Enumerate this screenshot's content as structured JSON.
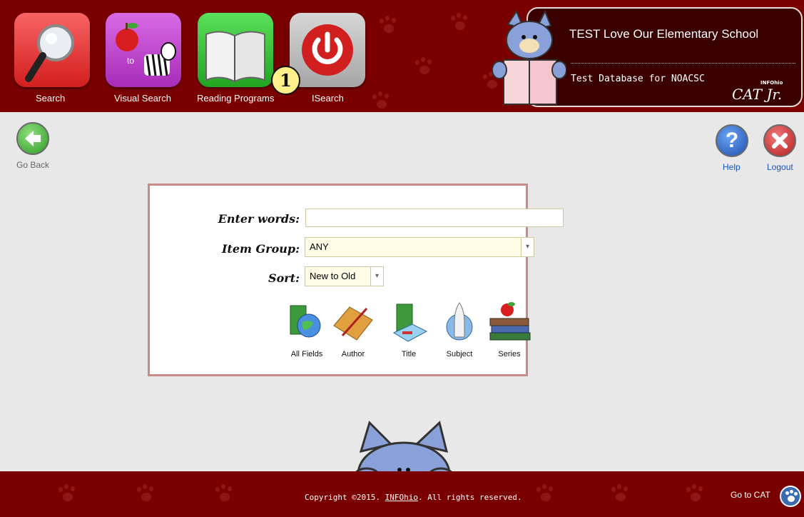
{
  "nav": [
    {
      "label": "Search",
      "icon": "magnifier-icon",
      "color": "#e53a3a"
    },
    {
      "label": "Visual Search",
      "icon": "apple-to-zebra-icon",
      "color": "#c13ccf",
      "inner_text": "to"
    },
    {
      "label": "Reading Programs",
      "icon": "open-book-icon",
      "color": "#33c233"
    },
    {
      "label": "ISearch",
      "icon": "power-icon",
      "color": "#b0b0b0"
    }
  ],
  "header": {
    "school_name": "TEST Love Our Elementary School",
    "database_name": "Test Database for NOACSC",
    "brand_small": "INFOhio",
    "brand_main": "CAT Jr."
  },
  "actions": {
    "go_back": "Go Back",
    "help": "Help",
    "logout": "Logout"
  },
  "search_form": {
    "enter_words_label": "Enter words:",
    "enter_words_value": "",
    "item_group_label": "Item Group:",
    "item_group_value": "ANY",
    "sort_label": "Sort:",
    "sort_value": "New to Old"
  },
  "search_types": [
    {
      "label": "All Fields",
      "icon": "globe-book-icon"
    },
    {
      "label": "Author",
      "icon": "pencil-book-icon"
    },
    {
      "label": "Title",
      "icon": "book-title-icon"
    },
    {
      "label": "Subject",
      "icon": "rocket-globe-icon"
    },
    {
      "label": "Series",
      "icon": "book-stack-apple-icon"
    }
  ],
  "footer": {
    "copyright_prefix": "Copyright ©2015.",
    "copyright_link": "INFOhio",
    "copyright_suffix": ". All rights reserved.",
    "goto_cat": "Go to CAT"
  },
  "annotation": {
    "badge": "1"
  },
  "colors": {
    "header_bg": "#7a0000",
    "box_border": "#c98a8a",
    "page_bg": "#e8e8e8"
  }
}
